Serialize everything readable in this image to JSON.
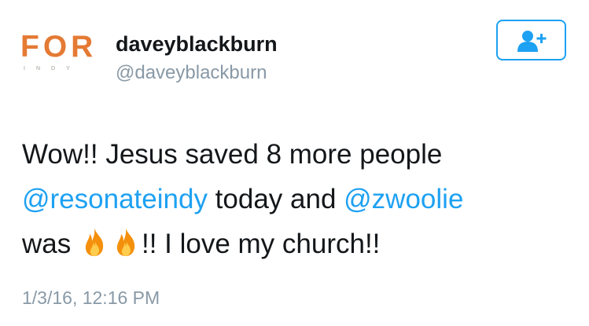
{
  "user": {
    "avatar_logo_text": "FOR",
    "avatar_logo_subtext": "INDY",
    "display_name": "daveyblackburn",
    "handle": "@daveyblackburn"
  },
  "follow_button": {
    "icon": "add-user-icon"
  },
  "tweet": {
    "line1": "Wow!! Jesus saved 8 more people",
    "mention1": "@resonateindy",
    "middle": " today and ",
    "mention2": "@zwoolie",
    "line3_start": "was ",
    "emoji": "fire",
    "line3_end": "!! I love my church!!"
  },
  "timestamp": "1/3/16, 12:16 PM",
  "colors": {
    "accent": "#1da1f2",
    "brand_orange": "#e47a34",
    "text": "#14171a",
    "secondary": "#8899a6"
  }
}
